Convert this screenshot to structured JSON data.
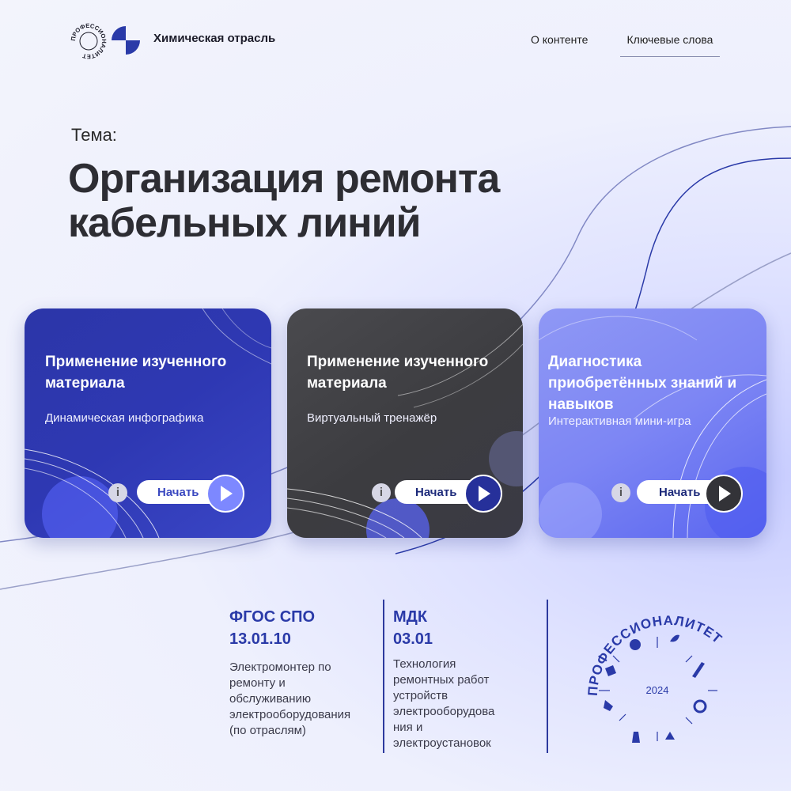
{
  "header": {
    "logo_text": "ПРОФЕССИОНАЛИТЕТ",
    "brand": "Химическая отрасль",
    "nav": {
      "about": "О контенте",
      "keywords": "Ключевые слова"
    }
  },
  "topic": {
    "label": "Тема:",
    "title_line1": "Организация ремонта",
    "title_line2": "кабельных линий"
  },
  "cards": [
    {
      "title": "Применение изученного материала",
      "subtitle": "Динамическая инфографика",
      "info_icon": "i",
      "start_label": "Начать"
    },
    {
      "title": "Применение изученного материала",
      "subtitle": "Виртуальный тренажёр",
      "info_icon": "i",
      "start_label": "Начать"
    },
    {
      "title": "Диагностика приобретённых знаний и навыков",
      "subtitle": "Интерактивная мини-игра",
      "info_icon": "i",
      "start_label": "Начать"
    }
  ],
  "fgos": {
    "head_line1": "ФГОС СПО",
    "head_line2": "13.01.10",
    "text": [
      "Электромонтер по",
      "ремонту и",
      "обслуживанию",
      "электрооборудования",
      "(по отраслям)"
    ]
  },
  "mdk": {
    "head_line1": "МДК",
    "head_line2": "03.01",
    "text": [
      "Технология",
      "ремонтных работ",
      "устройств",
      "электрооборудова",
      "ния и",
      "электроустановок"
    ]
  },
  "badge": {
    "text": "ПРОФЕССИОНАЛИТЕТ",
    "year": "2024"
  },
  "colors": {
    "accent": "#2a3aa8",
    "card1": "#2e38b3",
    "card2": "#3c3c40",
    "card3": "#7d86f4"
  },
  "icons": {
    "info": "info-icon",
    "play": "play-icon"
  }
}
